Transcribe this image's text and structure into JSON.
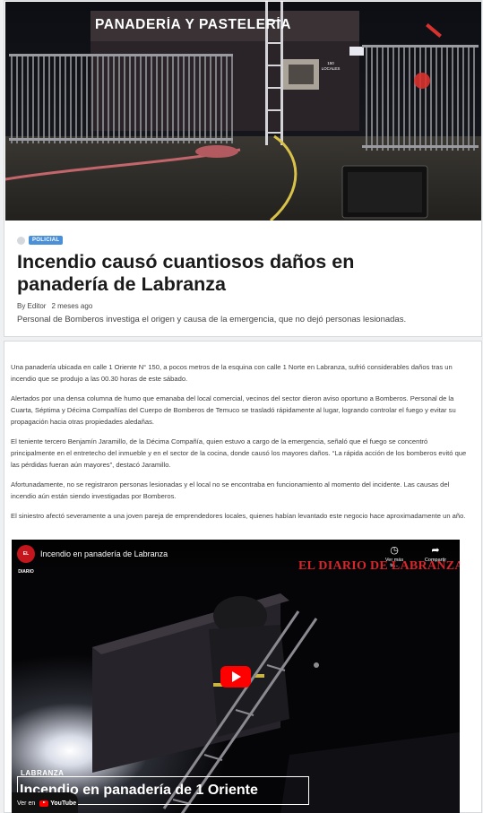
{
  "hero": {
    "sign_text": "PANADERÍA Y PASTELERÍA",
    "number_plate": "150 LOCALES"
  },
  "article_header": {
    "category": "POLICIAL",
    "title": "Incendio causó cuantiosos daños en panadería de Labranza",
    "author": "By Editor",
    "date": "2 meses ago",
    "summary": "Personal de Bomberos investiga el origen y causa de la emergencia, que no dejó personas lesionadas."
  },
  "body": {
    "paragraphs": [
      "Una panadería ubicada en calle 1 Oriente N° 150, a pocos metros de la esquina con calle 1 Norte en Labranza, sufrió considerables daños tras un incendio que se produjo a las 00.30 horas de este sábado.",
      "Alertados por una densa columna de humo que emanaba del local comercial, vecinos del sector dieron aviso oportuno a Bomberos. Personal de la Cuarta, Séptima y Décima Compañías del Cuerpo de Bomberos de Temuco se trasladó rápidamente al lugar, logrando controlar el fuego y evitar su propagación hacia otras propiedades aledañas.",
      "El teniente tercero Benjamín Jaramillo, de la Décima Compañía, quien estuvo a cargo de la emergencia, señaló que el fuego se concentró principalmente en el entretecho del inmueble y en el sector de la cocina, donde causó los mayores daños. “La rápida acción de los bomberos evitó que las pérdidas fueran aún mayores”, destacó Jaramillo.",
      "Afortunadamente, no se registraron personas lesionadas y el local no se encontraba en funcionamiento al momento del incidente. Las causas del incendio aún están siendo investigadas por Bomberos.",
      "El siniestro afectó severamente a una joven pareja de emprendedores locales, quienes habían levantado este negocio hace aproximadamente un año."
    ]
  },
  "video": {
    "channel_badge": "EL DIARIO",
    "title": "Incendio en panadería de Labranza",
    "watch_later_label": "Ver más ta...",
    "share_label": "Compartir",
    "brand_overlay": "EL DIARIO DE LABRANZA",
    "lower_kicker": "LABRANZA",
    "lower_title": "Incendio en panadería de 1 Oriente",
    "watch_on": "Ver en",
    "youtube": "YouTube"
  },
  "colors": {
    "category_badge": "#4a90d9",
    "brand_red": "#d6262c",
    "play_red": "#ff0000"
  }
}
